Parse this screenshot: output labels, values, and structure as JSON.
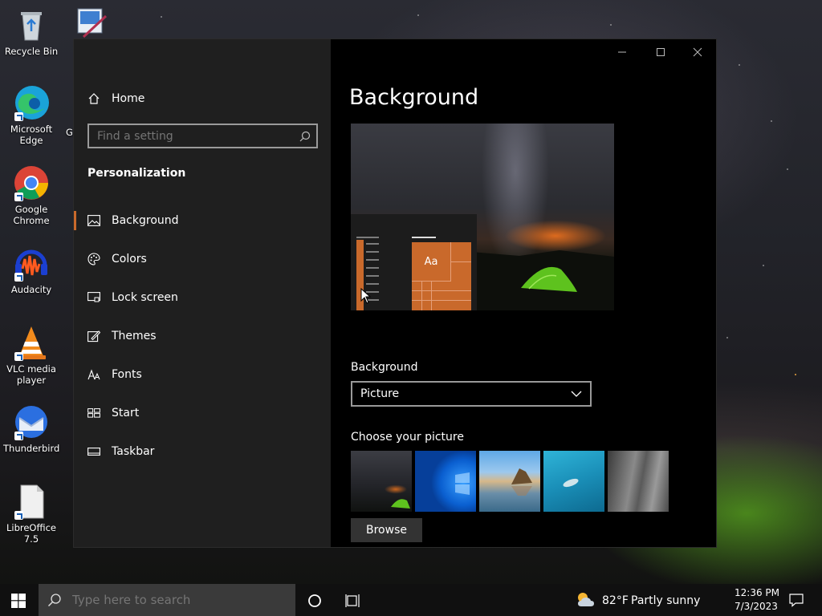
{
  "desktop": {
    "icons": [
      {
        "label": "Recycle Bin"
      },
      {
        "label": "Microsoft Edge"
      },
      {
        "label": "Google Chrome"
      },
      {
        "label": "Audacity"
      },
      {
        "label": "VLC media player"
      },
      {
        "label": "Thunderbird"
      },
      {
        "label": "LibreOffice 7.5"
      }
    ],
    "partial_label": "Gc"
  },
  "settings": {
    "nav": {
      "home_label": "Home",
      "search_placeholder": "Find a setting",
      "section_title": "Personalization",
      "items": [
        {
          "label": "Background",
          "icon": "picture-icon",
          "selected": true
        },
        {
          "label": "Colors",
          "icon": "palette-icon"
        },
        {
          "label": "Lock screen",
          "icon": "lock-screen-icon"
        },
        {
          "label": "Themes",
          "icon": "themes-icon"
        },
        {
          "label": "Fonts",
          "icon": "fonts-icon"
        },
        {
          "label": "Start",
          "icon": "start-icon"
        },
        {
          "label": "Taskbar",
          "icon": "taskbar-icon"
        }
      ]
    },
    "page_title": "Background",
    "preview": {
      "tile_text": "Aa"
    },
    "background_label": "Background",
    "background_value": "Picture",
    "choose_label": "Choose your picture",
    "browse_label": "Browse",
    "accent_color": "#c9692b"
  },
  "taskbar": {
    "search_placeholder": "Type here to search",
    "temperature": "82°F",
    "weather": "Partly sunny",
    "time": "12:36 PM",
    "date": "7/3/2023"
  }
}
